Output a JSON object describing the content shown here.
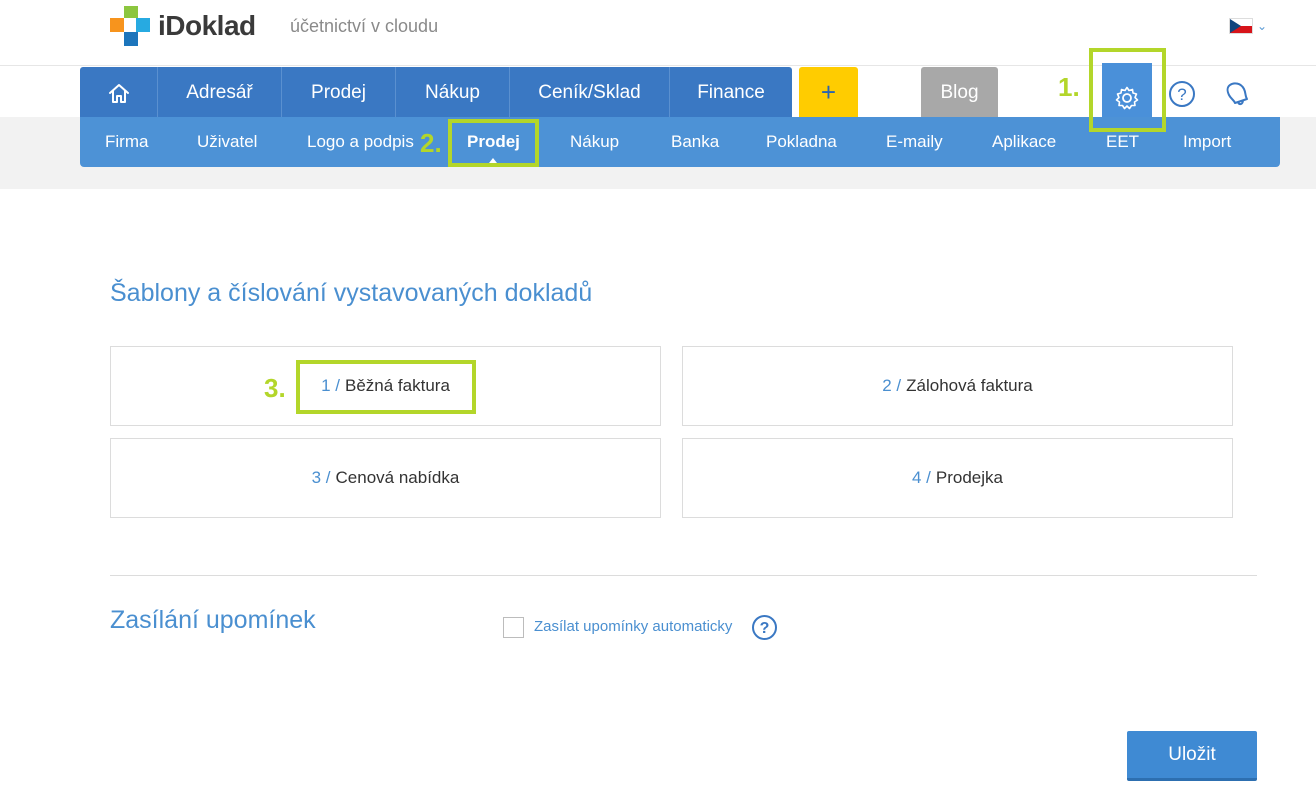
{
  "header": {
    "brand": "iDoklad",
    "tagline": "účetnictví v cloudu",
    "language_icon": "czech-flag-icon"
  },
  "main_nav": {
    "home_icon": "home-icon",
    "items": [
      {
        "label": "Adresář"
      },
      {
        "label": "Prodej"
      },
      {
        "label": "Nákup"
      },
      {
        "label": "Ceník/Sklad"
      },
      {
        "label": "Finance"
      }
    ],
    "add_label": "+",
    "blog_label": "Blog",
    "settings_icon": "gear-icon",
    "help_icon": "question-circle-icon",
    "notifications_icon": "bell-icon"
  },
  "sub_nav": {
    "items": [
      {
        "label": "Firma"
      },
      {
        "label": "Uživatel"
      },
      {
        "label": "Logo a podpis"
      },
      {
        "label": "Prodej"
      },
      {
        "label": "Nákup"
      },
      {
        "label": "Banka"
      },
      {
        "label": "Pokladna"
      },
      {
        "label": "E-maily"
      },
      {
        "label": "Aplikace"
      },
      {
        "label": "EET"
      },
      {
        "label": "Import"
      }
    ],
    "active": "Prodej"
  },
  "annotations": {
    "step1": "1.",
    "step2": "2.",
    "step3": "3."
  },
  "templates_section": {
    "title": "Šablony a číslování vystavovaných dokladů",
    "cards": [
      {
        "num": "1 /",
        "label": "Běžná faktura"
      },
      {
        "num": "2 /",
        "label": "Zálohová faktura"
      },
      {
        "num": "3 /",
        "label": "Cenová nabídka"
      },
      {
        "num": "4 /",
        "label": "Prodejka"
      }
    ]
  },
  "reminders_section": {
    "title": "Zasílání upomínek",
    "checkbox_label": "Zasílat upomínky automaticky",
    "checked": false
  },
  "actions": {
    "save_label": "Uložit"
  },
  "colors": {
    "accent": "#3a78c3",
    "highlight": "#b3d62a",
    "plus": "#ffcc00"
  }
}
